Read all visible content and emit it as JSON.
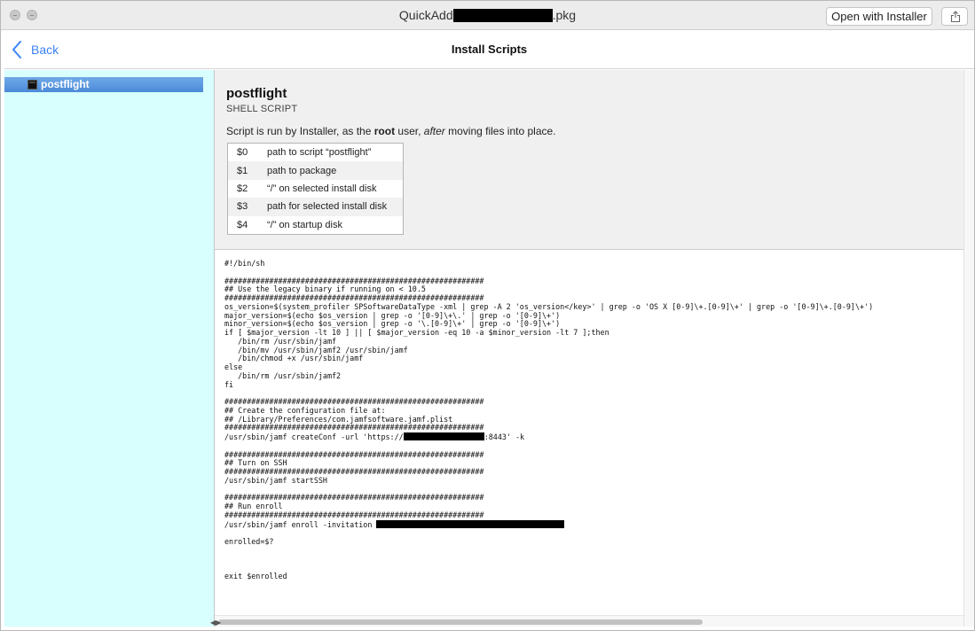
{
  "window": {
    "title_prefix": "QuickAdd",
    "title_suffix": ".pkg",
    "open_with_label": "Open with Installer",
    "share_icon": "share-icon"
  },
  "navbar": {
    "back_label": "Back",
    "title": "Install Scripts"
  },
  "sidebar": {
    "items": [
      {
        "label": "postflight",
        "icon": "terminal-icon",
        "selected": true
      }
    ]
  },
  "script": {
    "name": "postflight",
    "kind": "SHELL SCRIPT",
    "desc_before": "Script is run by Installer, as the ",
    "desc_bold": "root",
    "desc_middle": " user, ",
    "desc_italic": "after",
    "desc_after": " moving files into place.",
    "args": [
      {
        "var": "$0",
        "desc": "path to script “postflight”"
      },
      {
        "var": "$1",
        "desc": "path to package"
      },
      {
        "var": "$2",
        "desc": "“/” on selected install disk"
      },
      {
        "var": "$3",
        "desc": "path for selected install disk"
      },
      {
        "var": "$4",
        "desc": "“/” on startup disk"
      }
    ]
  },
  "code": {
    "l01": "#!/bin/sh",
    "l02": "",
    "l03": "##########################################################",
    "l04": "## Use the legacy binary if running on < 10.5",
    "l05": "##########################################################",
    "l06": "os_version=$(system_profiler SPSoftwareDataType -xml | grep -A 2 'os_version</key>' | grep -o 'OS X [0-9]\\+.[0-9]\\+' | grep -o '[0-9]\\+.[0-9]\\+')",
    "l07": "major_version=$(echo $os_version | grep -o '[0-9]\\+\\.' | grep -o '[0-9]\\+')",
    "l08": "minor_version=$(echo $os_version | grep -o '\\.[0-9]\\+' | grep -o '[0-9]\\+')",
    "l09": "if [ $major_version -lt 10 ] || [ $major_version -eq 10 -a $minor_version -lt 7 ];then",
    "l10": "   /bin/rm /usr/sbin/jamf",
    "l11": "   /bin/mv /usr/sbin/jamf2 /usr/sbin/jamf",
    "l12": "   /bin/chmod +x /usr/sbin/jamf",
    "l13": "else",
    "l14": "   /bin/rm /usr/sbin/jamf2",
    "l15": "fi",
    "l16": "",
    "l17": "##########################################################",
    "l18": "## Create the configuration file at:",
    "l19": "## /Library/Preferences/com.jamfsoftware.jamf.plist",
    "l20": "##########################################################",
    "l21a": "/usr/sbin/jamf createConf -url 'https://",
    "l21b": ":8443' -k",
    "l22": "",
    "l23": "##########################################################",
    "l24": "## Turn on SSH",
    "l25": "##########################################################",
    "l26": "/usr/sbin/jamf startSSH",
    "l27": "",
    "l28": "##########################################################",
    "l29": "## Run enroll",
    "l30": "##########################################################",
    "l31": "/usr/sbin/jamf enroll -invitation ",
    "l32": "",
    "l33": "enrolled=$?",
    "l34": "",
    "l35": "",
    "l36": "",
    "l37": "exit $enrolled"
  }
}
